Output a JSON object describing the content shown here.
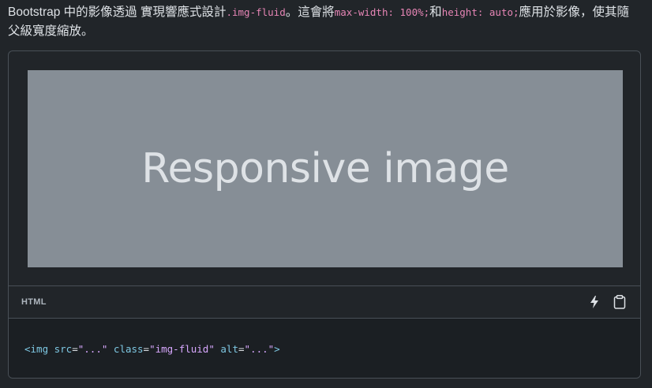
{
  "intro": {
    "text_before": "Bootstrap 中的影像透過 實現響應式設計",
    "class_code": ".img-fluid",
    "text_middle": "。這會將",
    "maxwidth_code": "max-width: 100%;",
    "text_and": "和",
    "height_code": "height: auto;",
    "text_after": "應用於影像，使其隨父級寬度縮放。"
  },
  "preview": {
    "placeholder_label": "Responsive image"
  },
  "code_header": {
    "language": "HTML",
    "actions": [
      {
        "name": "run-icon"
      },
      {
        "name": "clipboard-icon"
      }
    ]
  },
  "code": {
    "tag_open": "<img",
    "attr1": " src",
    "eq1": "=",
    "val1": "\"...\"",
    "attr2": " class",
    "eq2": "=",
    "val2": "\"img-fluid\"",
    "attr3": " alt",
    "eq3": "=",
    "val3": "\"...\"",
    "tag_close": ">"
  },
  "colors": {
    "background": "#212529",
    "placeholder": "#868e96",
    "code_highlight": "#e685b5"
  }
}
